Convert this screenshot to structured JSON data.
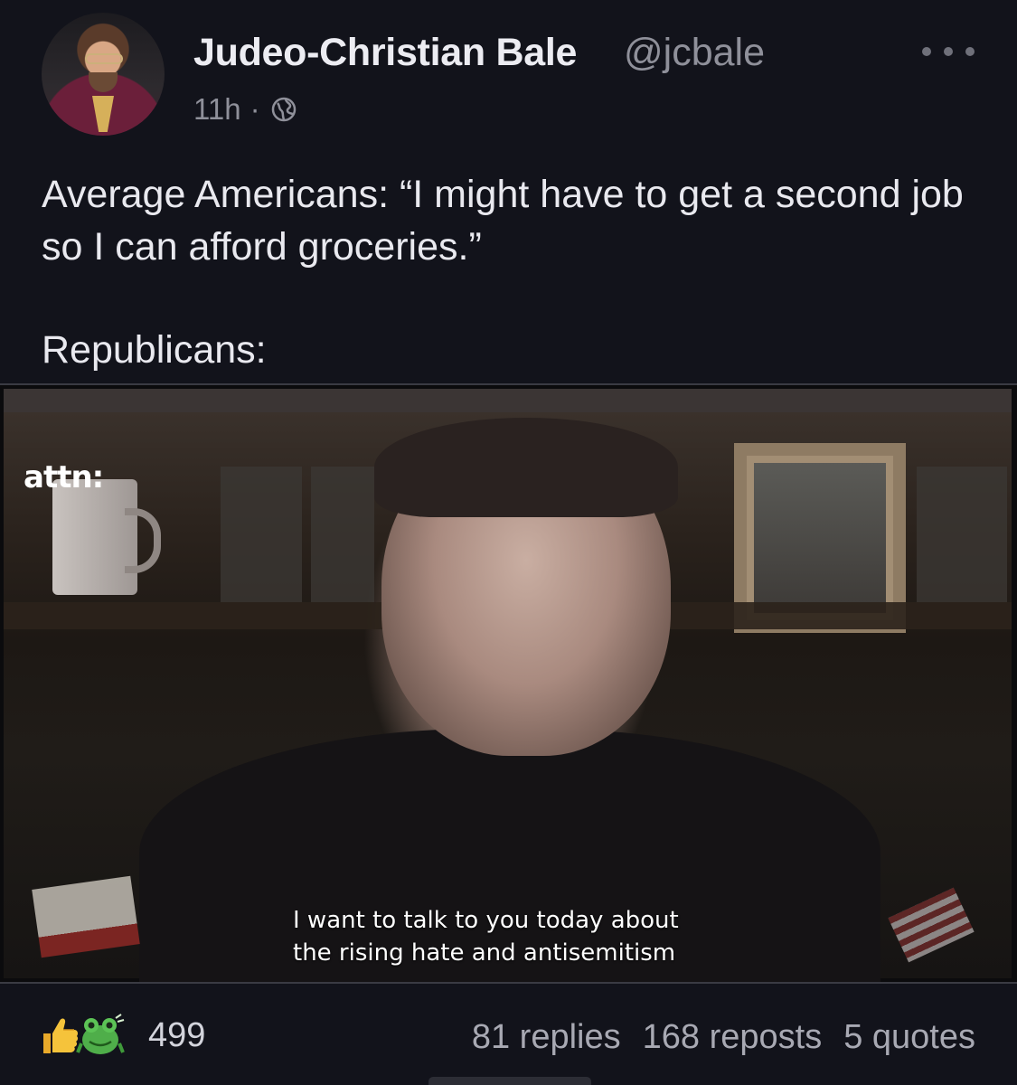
{
  "post": {
    "author": {
      "display_name": "Judeo-Christian Bale",
      "handle": "@jcbale",
      "avatar_icon": "avatar"
    },
    "time": "11h",
    "separator": "·",
    "visibility_icon": "globe-icon",
    "text": {
      "line1": "Average Americans: “I might have to get a second job so I can afford groceries.”",
      "line2": "Republicans:"
    },
    "media": {
      "watermark": "attn:",
      "caption_line1": "I want to talk to you today about",
      "caption_line2": "the rising hate and antisemitism"
    },
    "footer": {
      "reaction_icons": [
        "thumbs-up-icon",
        "frog-icon"
      ],
      "reaction_count": "499",
      "replies": "81 replies",
      "reposts": "168 reposts",
      "quotes": "5 quotes"
    }
  },
  "colors": {
    "background": "#12131b",
    "text_primary": "#e9e9ef",
    "text_secondary": "#8f909a"
  }
}
